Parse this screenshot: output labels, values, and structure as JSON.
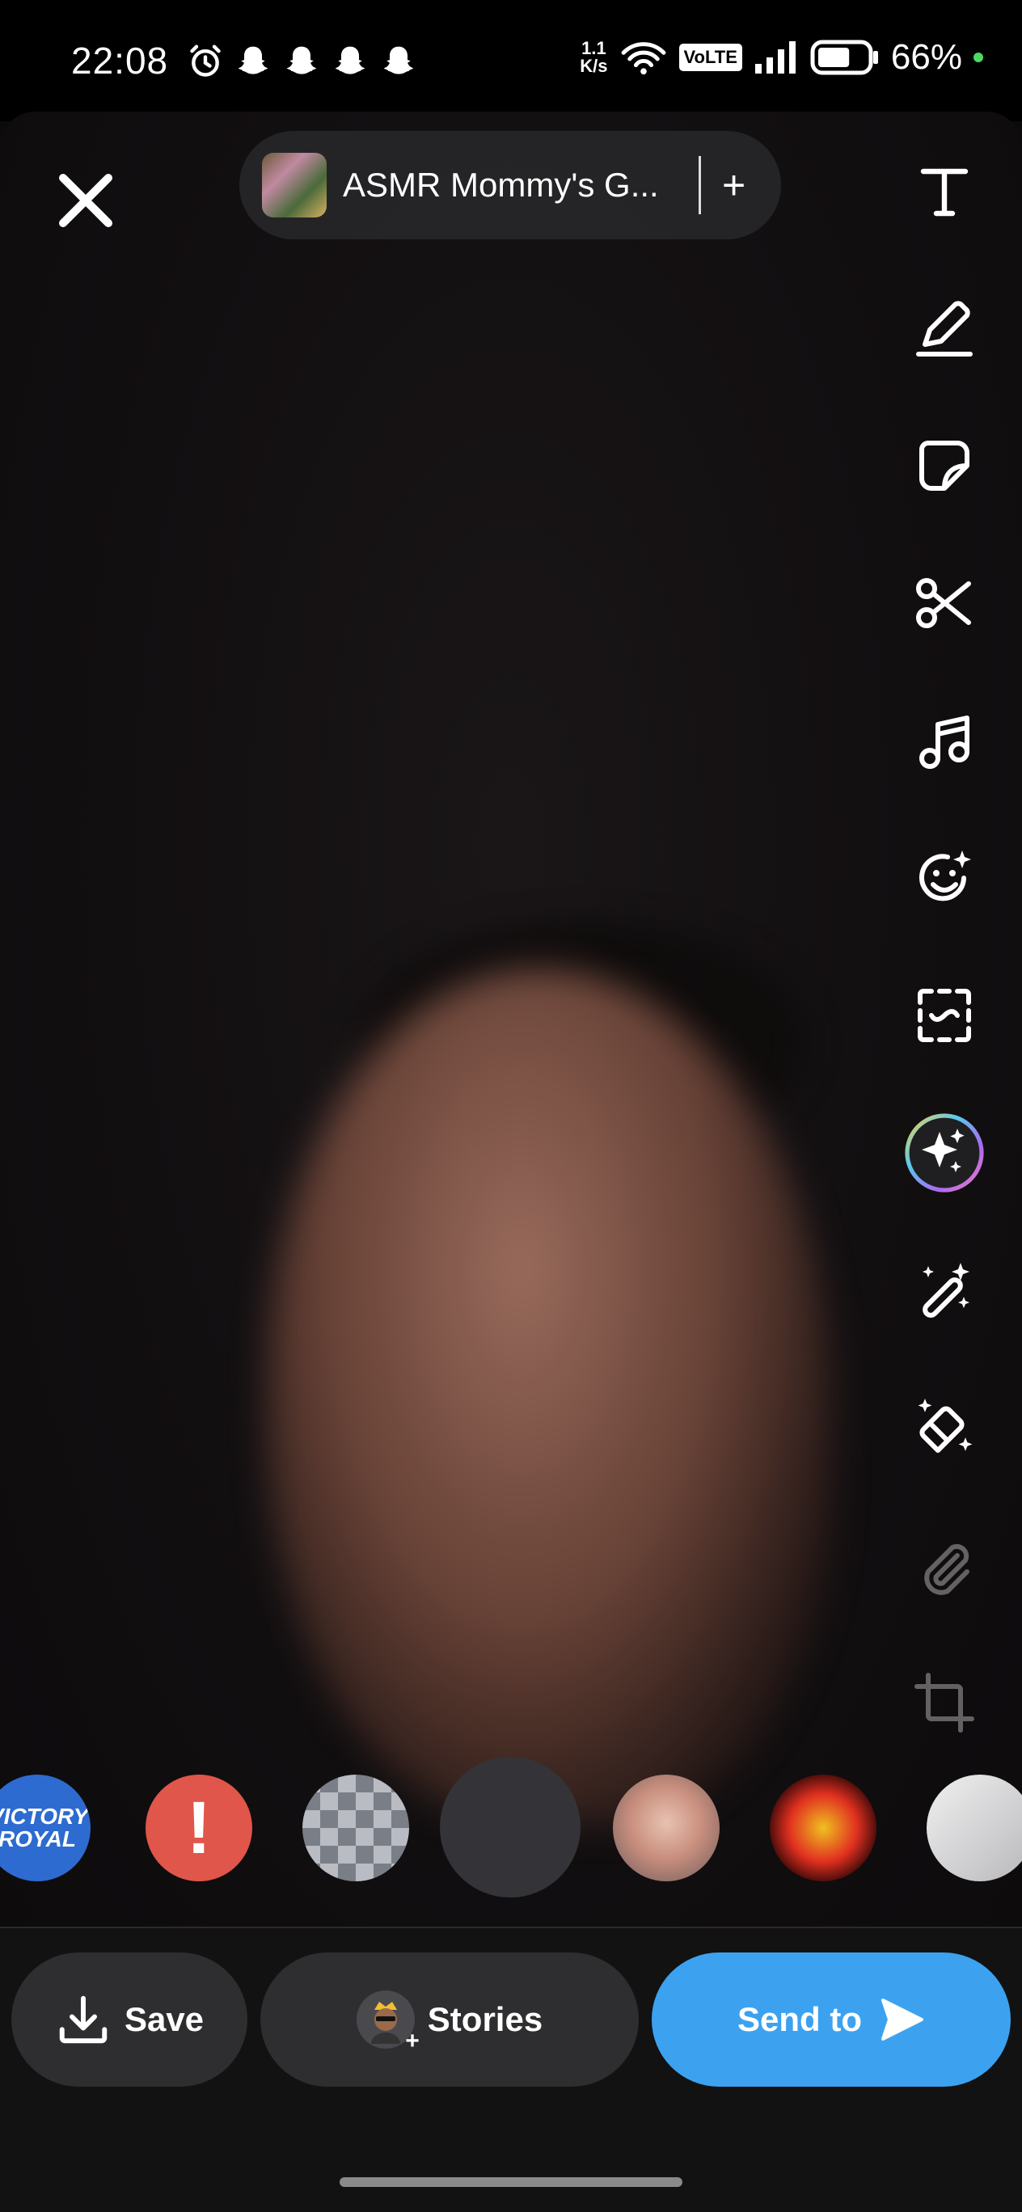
{
  "status_bar": {
    "time": "22:08",
    "net_speed_value": "1.1",
    "net_speed_unit": "K/s",
    "volte": "VoLTE",
    "battery_percent": "66%",
    "battery_level": 0.66,
    "icons": [
      "alarm-icon",
      "snapchat-icon",
      "snapchat-icon",
      "snapchat-icon",
      "snapchat-icon",
      "wifi-icon",
      "signal-icon",
      "battery-icon"
    ]
  },
  "header": {
    "title": "ASMR Mommy's G...",
    "add_label": "+"
  },
  "toolbar": {
    "tools": [
      "text-tool",
      "draw-tool",
      "sticker-tool",
      "scissors-tool",
      "music-tool",
      "lens-emoji-tool",
      "scan-tool",
      "ai-sparkle-tool",
      "magic-wand-tool",
      "eraser-tool",
      "attach-tool",
      "crop-tool"
    ]
  },
  "recipients": {
    "first_label": "VICTORY ROYAL",
    "alert_label": "!"
  },
  "actions": {
    "save_label": "Save",
    "stories_label": "Stories",
    "send_label": "Send to"
  },
  "colors": {
    "send_button": "#3ca2f0",
    "alert_red": "#e0564a",
    "pill_bg": "#28282a"
  }
}
